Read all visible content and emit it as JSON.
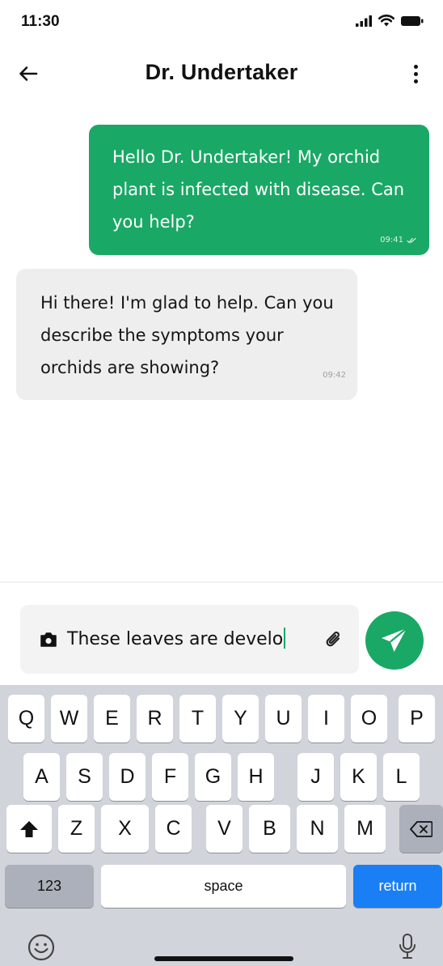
{
  "status_bar": {
    "time": "11:30"
  },
  "header": {
    "title": "Dr. Undertaker"
  },
  "messages": [
    {
      "direction": "outgoing",
      "text": "Hello Dr. Undertaker! My orchid plant is infected with disease. Can you help?",
      "time": "09:41"
    },
    {
      "direction": "incoming",
      "text": "Hi there! I'm glad to help. Can you describe the symptoms your orchids are showing?",
      "time": "09:42"
    }
  ],
  "composer": {
    "text": "These leaves are develo"
  },
  "keyboard": {
    "row1": [
      "Q",
      "W",
      "E",
      "R",
      "T",
      "Y",
      "U",
      "I",
      "O",
      "P"
    ],
    "row2": [
      "A",
      "S",
      "D",
      "F",
      "G",
      "H",
      "J",
      "K",
      "L"
    ],
    "row3": [
      "Z",
      "X",
      "C",
      "V",
      "B",
      "N",
      "M"
    ],
    "numbers_label": "123",
    "space_label": "space",
    "return_label": "return"
  },
  "colors": {
    "accent": "#1aa866",
    "incoming_bubble": "#eeeeee",
    "keyboard_bg": "#d1d4da",
    "return_key": "#1a7ef5"
  },
  "icons": [
    "back-arrow-icon",
    "more-vertical-icon",
    "camera-icon",
    "paperclip-icon",
    "send-icon",
    "shift-icon",
    "backspace-icon",
    "emoji-icon",
    "mic-icon",
    "signal-icon",
    "wifi-icon",
    "battery-icon",
    "double-check-icon"
  ]
}
